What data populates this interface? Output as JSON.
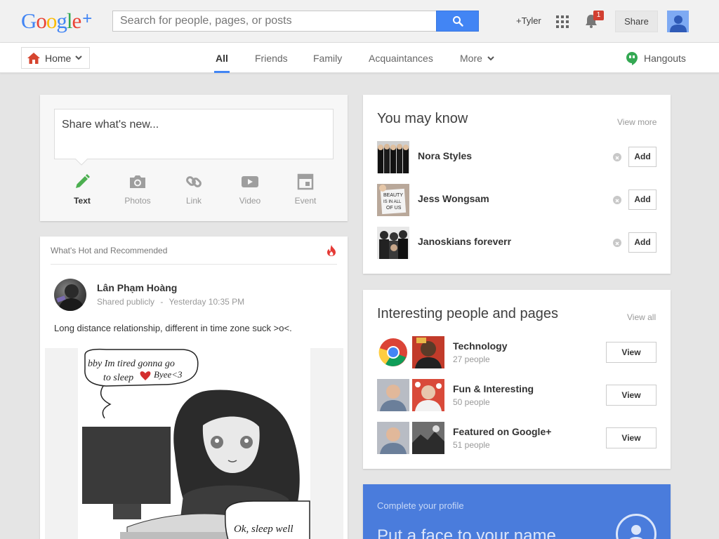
{
  "header": {
    "logo_text": "Google",
    "logo_plus": "+",
    "search_placeholder": "Search for people, pages, or posts",
    "user_label": "+Tyler",
    "notification_count": "1",
    "share_label": "Share"
  },
  "nav": {
    "home_label": "Home",
    "tabs": [
      {
        "label": "All",
        "active": true
      },
      {
        "label": "Friends"
      },
      {
        "label": "Family"
      },
      {
        "label": "Acquaintances"
      },
      {
        "label": "More"
      }
    ],
    "hangouts_label": "Hangouts"
  },
  "share_box": {
    "placeholder": "Share what's new...",
    "tools": [
      {
        "label": "Text",
        "icon": "pencil-icon",
        "active": true
      },
      {
        "label": "Photos",
        "icon": "camera-icon"
      },
      {
        "label": "Link",
        "icon": "link-icon"
      },
      {
        "label": "Video",
        "icon": "video-icon"
      },
      {
        "label": "Event",
        "icon": "event-icon"
      }
    ]
  },
  "hot": {
    "title": "What's Hot and Recommended",
    "post": {
      "author": "Lân Phạm Hoàng",
      "visibility": "Shared publicly",
      "separator": "-",
      "time": "Yesterday 10:35 PM",
      "text": "Long distance relationship, different in time zone suck >o<.",
      "image_text_1": "bby Im tired gonna go",
      "image_text_2": "to sleep",
      "image_text_3": "Byee<3",
      "image_text_4": "Ok, sleep well"
    }
  },
  "you_may_know": {
    "title": "You may know",
    "link": "View more",
    "add_label": "Add",
    "people": [
      {
        "name": "Nora Styles"
      },
      {
        "name": "Jess Wongsam",
        "photo_text_1": "BEAUTY",
        "photo_text_2": "IS IN ALL",
        "photo_text_3": "OF US"
      },
      {
        "name": "Janoskians foreverr"
      }
    ]
  },
  "interesting": {
    "title": "Interesting people and pages",
    "link": "View all",
    "view_label": "View",
    "groups": [
      {
        "name": "Technology",
        "count": "27 people"
      },
      {
        "name": "Fun & Interesting",
        "count": "50 people"
      },
      {
        "name": "Featured on Google+",
        "count": "51 people"
      }
    ]
  },
  "profile": {
    "subtitle": "Complete your profile",
    "title": "Put a face to your name"
  },
  "colors": {
    "accent": "#4285f4",
    "notification": "#d23f31",
    "profile_card": "#4a7cdc",
    "text_tool_active": "#4caf50"
  }
}
